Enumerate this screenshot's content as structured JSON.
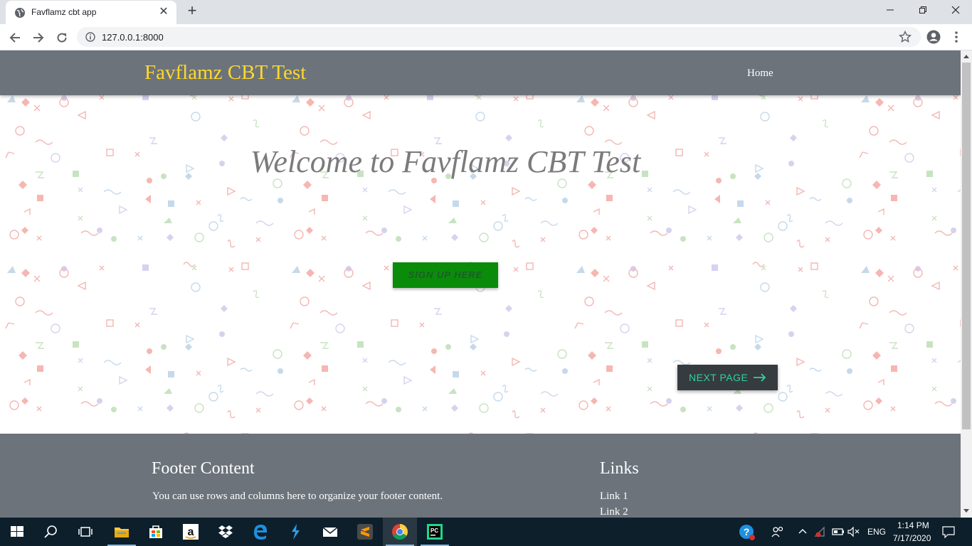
{
  "browser": {
    "tab_title": "Favflamz cbt app",
    "url": "127.0.0.1:8000"
  },
  "site": {
    "brand": "Favflamz CBT Test",
    "nav_home": "Home",
    "headline": "Welcome to Favflamz CBT Test",
    "signup_label": "SIGN UP HERE",
    "next_label": "NEXT PAGE",
    "footer": {
      "title": "Footer Content",
      "text": "You can use rows and columns here to organize your footer content.",
      "links_title": "Links",
      "links": [
        "Link 1",
        "Link 2"
      ]
    }
  },
  "taskbar": {
    "language": "ENG",
    "time": "1:14 PM",
    "date": "7/17/2020",
    "apps": [
      "start-icon",
      "search-icon",
      "task-view-icon",
      "file-explorer-icon",
      "store-icon",
      "amazon-icon",
      "dropbox-icon",
      "edge-icon",
      "visual-studio-icon",
      "mail-icon",
      "sublime-text-icon",
      "chrome-icon",
      "pycharm-icon"
    ]
  },
  "colors": {
    "navbar_bg": "#6c737b",
    "brand_text": "#ffd82a",
    "signup_bg": "#0a8c0a",
    "next_bg": "#363b40",
    "next_text": "#2ed39a"
  }
}
